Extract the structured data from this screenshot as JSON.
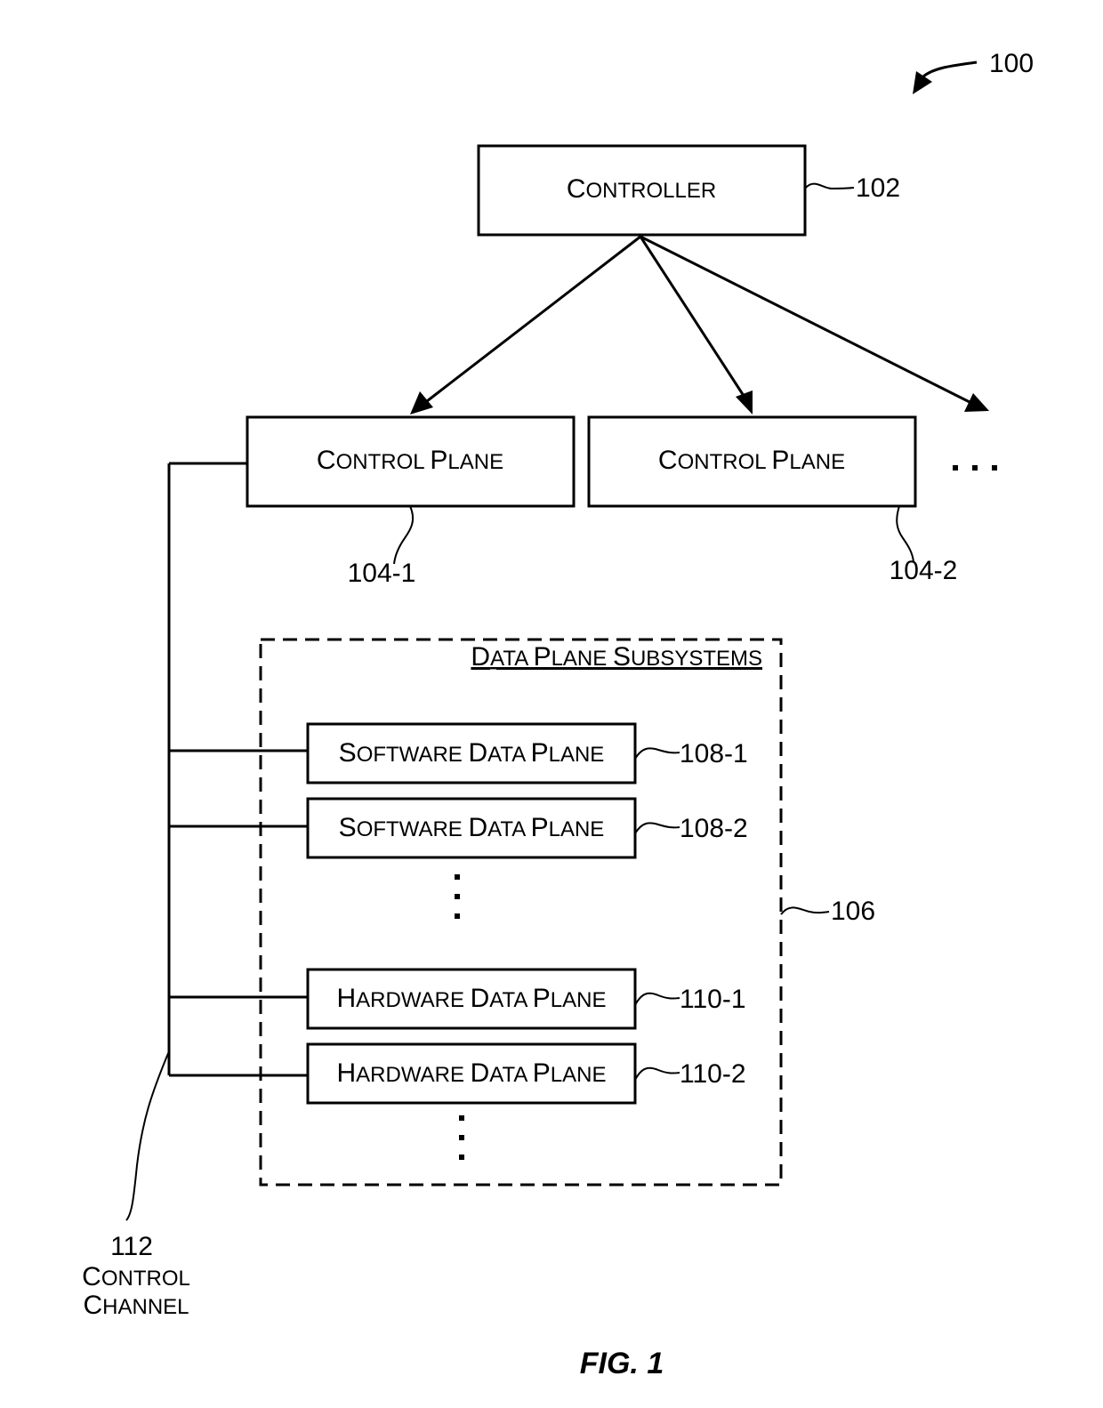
{
  "figure": {
    "number_label": "FIG. 1",
    "ref_system": "100"
  },
  "controller": {
    "label_first": "C",
    "label_rest": "ONTROLLER",
    "ref": "102"
  },
  "control_planes": [
    {
      "label_parts": [
        "C",
        "ONTROL ",
        "P",
        "LANE"
      ],
      "ref": "104-1"
    },
    {
      "label_parts": [
        "C",
        "ONTROL ",
        "P",
        "LANE"
      ],
      "ref": "104-2"
    }
  ],
  "more_control_planes": "...",
  "data_plane_group": {
    "title_parts": [
      "D",
      "ATA ",
      "P",
      "LANE ",
      "S",
      "UBSYSTEMS"
    ],
    "ref": "106"
  },
  "software_data_planes": [
    {
      "label_parts": [
        "S",
        "OFTWARE ",
        "D",
        "ATA ",
        "P",
        "LANE"
      ],
      "ref": "108-1"
    },
    {
      "label_parts": [
        "S",
        "OFTWARE ",
        "D",
        "ATA ",
        "P",
        "LANE"
      ],
      "ref": "108-2"
    }
  ],
  "hardware_data_planes": [
    {
      "label_parts": [
        "H",
        "ARDWARE ",
        "D",
        "ATA ",
        "P",
        "LANE"
      ],
      "ref": "110-1"
    },
    {
      "label_parts": [
        "H",
        "ARDWARE ",
        "D",
        "ATA ",
        "P",
        "LANE"
      ],
      "ref": "110-2"
    }
  ],
  "control_channel": {
    "ref": "112",
    "line1_parts": [
      "C",
      "ONTROL"
    ],
    "line2_parts": [
      "C",
      "HANNEL"
    ]
  }
}
